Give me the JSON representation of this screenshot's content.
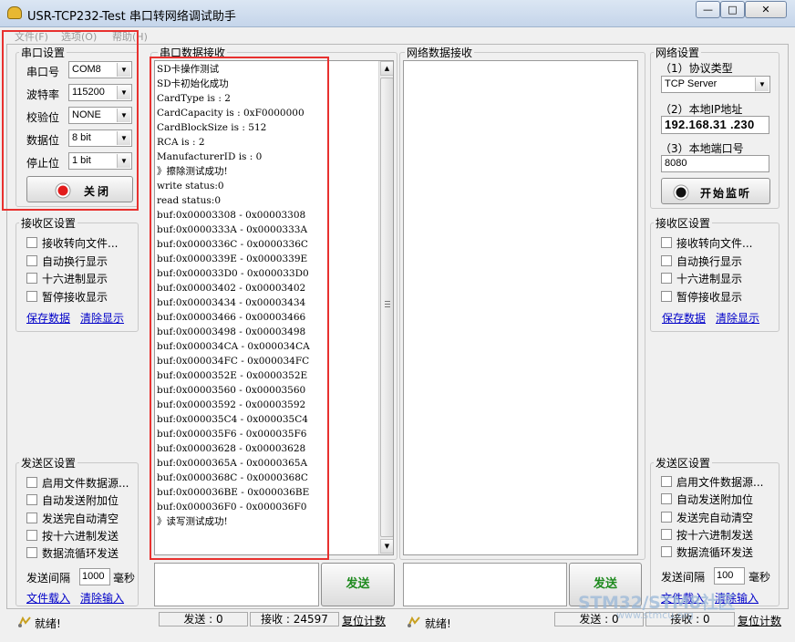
{
  "window": {
    "title": "USR-TCP232-Test 串口转网络调试助手",
    "btn_min": "—",
    "btn_max": "□",
    "btn_close": "✕"
  },
  "menu": [
    "文件(F)",
    "选项(O)",
    "帮助(H)"
  ],
  "serial_settings": {
    "title": "串口设置",
    "rows": [
      {
        "label": "串口号",
        "value": "COM8"
      },
      {
        "label": "波特率",
        "value": "115200"
      },
      {
        "label": "校验位",
        "value": "NONE"
      },
      {
        "label": "数据位",
        "value": "8 bit"
      },
      {
        "label": "停止位",
        "value": "1 bit"
      }
    ],
    "close_button": "关闭",
    "indicator_color": "#e21b1b"
  },
  "left_recv_settings": {
    "title": "接收区设置",
    "options": [
      "接收转向文件...",
      "自动换行显示",
      "十六进制显示",
      "暂停接收显示"
    ],
    "save_link": "保存数据",
    "clear_link": "清除显示"
  },
  "left_send_settings": {
    "title": "发送区设置",
    "options": [
      "启用文件数据源...",
      "自动发送附加位",
      "发送完自动清空",
      "按十六进制发送",
      "数据流循环发送"
    ],
    "interval_label": "发送间隔",
    "interval_value": "1000",
    "interval_unit": "毫秒",
    "load_link": "文件载入",
    "clear_link": "清除输入"
  },
  "serial_recv": {
    "title": "串口数据接收",
    "lines": [
      "SD卡操作测试",
      "SD卡初始化成功",
      "CardType is : 2",
      "CardCapacity is : 0xF0000000",
      "CardBlockSize is : 512",
      "RCA is : 2",
      "ManufacturerID is : 0",
      "》擦除测试成功!",
      "write status:0",
      "read status:0",
      "buf:0x00003308 - 0x00003308",
      "buf:0x0000333A - 0x0000333A",
      "buf:0x0000336C - 0x0000336C",
      "buf:0x0000339E - 0x0000339E",
      "buf:0x000033D0 - 0x000033D0",
      "buf:0x00003402 - 0x00003402",
      "buf:0x00003434 - 0x00003434",
      "buf:0x00003466 - 0x00003466",
      "buf:0x00003498 - 0x00003498",
      "buf:0x000034CA - 0x000034CA",
      "buf:0x000034FC - 0x000034FC",
      "buf:0x0000352E - 0x0000352E",
      "buf:0x00003560 - 0x00003560",
      "buf:0x00003592 - 0x00003592",
      "buf:0x000035C4 - 0x000035C4",
      "buf:0x000035F6 - 0x000035F6",
      "buf:0x00003628 - 0x00003628",
      "buf:0x0000365A - 0x0000365A",
      "buf:0x0000368C - 0x0000368C",
      "buf:0x000036BE - 0x000036BE",
      "buf:0x000036F0 - 0x000036F0",
      "》读写测试成功!"
    ]
  },
  "net_recv": {
    "title": "网络数据接收"
  },
  "serial_send_button": "发送",
  "net_send_button": "发送",
  "net_settings": {
    "title": "网络设置",
    "protocol_label": "（1）协议类型",
    "protocol_value": "TCP Server",
    "ip_label": "（2）本地IP地址",
    "ip_value": "192.168.31 .230",
    "port_label": "（3）本地端口号",
    "port_value": "8080",
    "listen_button": "开始监听",
    "indicator_color": "#111111"
  },
  "right_recv_settings": {
    "title": "接收区设置",
    "options": [
      "接收转向文件...",
      "自动换行显示",
      "十六进制显示",
      "暂停接收显示"
    ],
    "save_link": "保存数据",
    "clear_link": "清除显示"
  },
  "right_send_settings": {
    "title": "发送区设置",
    "options": [
      "启用文件数据源...",
      "自动发送附加位",
      "发送完自动清空",
      "按十六进制发送",
      "数据流循环发送"
    ],
    "interval_label": "发送间隔",
    "interval_value": "100",
    "interval_unit": "毫秒",
    "load_link": "文件载入",
    "clear_link": "清除输入"
  },
  "status_left": {
    "ready": "就绪!",
    "send": "发送 : 0",
    "recv": "接收 : 24597",
    "reset": "复位计数"
  },
  "status_right": {
    "ready": "就绪!",
    "send": "发送 : 0",
    "recv": "接收 : 0",
    "reset": "复位计数"
  },
  "watermark": {
    "line1": "STM32/STM8社区",
    "line2": "www.stmcu.org"
  },
  "highlight_color": "#e8312f"
}
